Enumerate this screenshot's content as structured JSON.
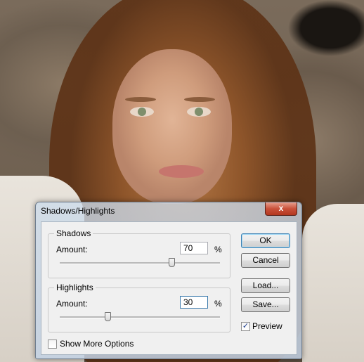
{
  "dialog": {
    "title": "Shadows/Highlights",
    "close_glyph": "x",
    "shadows": {
      "label": "Shadows",
      "amount_label": "Amount:",
      "amount_value": "70",
      "unit": "%",
      "slider_fraction": 0.7
    },
    "highlights": {
      "label": "Highlights",
      "amount_label": "Amount:",
      "amount_value": "30",
      "unit": "%",
      "slider_fraction": 0.3
    },
    "buttons": {
      "ok": "OK",
      "cancel": "Cancel",
      "load": "Load...",
      "save": "Save..."
    },
    "preview": {
      "label": "Preview",
      "checked": true,
      "mark": "✓"
    },
    "more_options": {
      "label": "Show More Options",
      "checked": false
    }
  },
  "colors": {
    "close_button": "#c9513a",
    "default_button_border": "#3c7fb1",
    "dialog_frame": "#c3d2e4"
  },
  "icons": {
    "close": "close-icon",
    "check": "checkmark-icon"
  }
}
